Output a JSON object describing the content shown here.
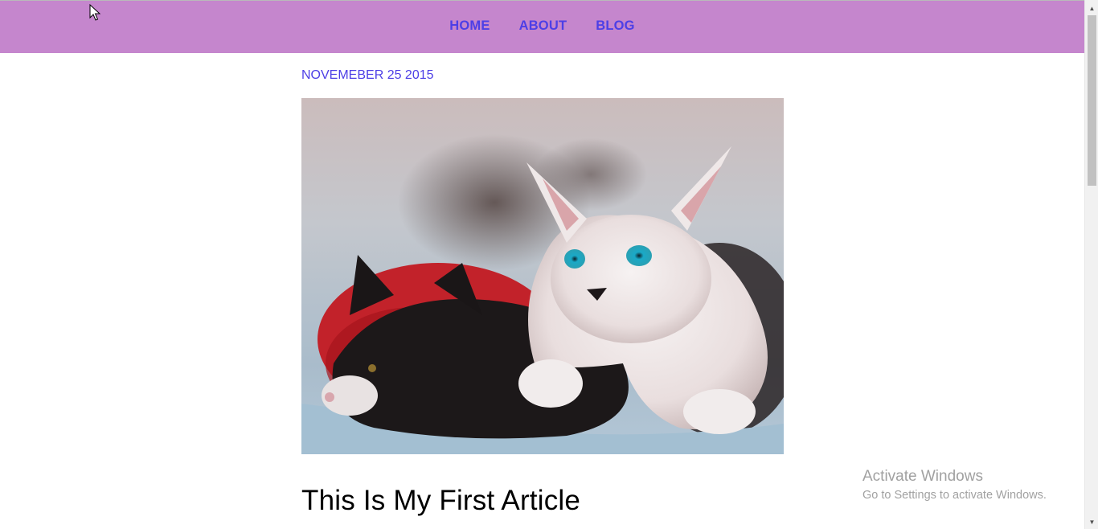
{
  "nav": {
    "items": [
      {
        "label": "HOME"
      },
      {
        "label": "ABOUT"
      },
      {
        "label": "BLOG"
      }
    ]
  },
  "article": {
    "date": "NOVEMEBER 25 2015",
    "image": {
      "subject": "two kittens"
    },
    "title": "This Is My First Article"
  },
  "watermark": {
    "title": "Activate Windows",
    "subtitle": "Go to Settings to activate Windows."
  },
  "colors": {
    "navbar_bg": "#c586cd",
    "link": "#4d3fe6"
  },
  "icons": [
    "mouse-pointer-icon",
    "scroll-up-arrow-icon",
    "scroll-down-arrow-icon"
  ]
}
